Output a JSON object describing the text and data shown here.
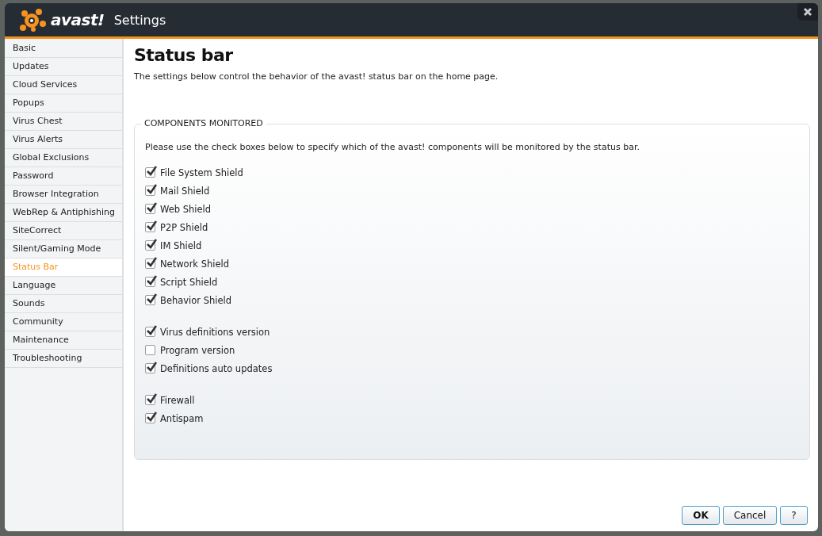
{
  "window": {
    "logo": "avast!",
    "title": "Settings"
  },
  "sidebar": {
    "items": [
      {
        "label": "Basic",
        "selected": false
      },
      {
        "label": "Updates",
        "selected": false
      },
      {
        "label": "Cloud Services",
        "selected": false
      },
      {
        "label": "Popups",
        "selected": false
      },
      {
        "label": "Virus Chest",
        "selected": false
      },
      {
        "label": "Virus Alerts",
        "selected": false
      },
      {
        "label": "Global Exclusions",
        "selected": false
      },
      {
        "label": "Password",
        "selected": false
      },
      {
        "label": "Browser Integration",
        "selected": false
      },
      {
        "label": "WebRep & Antiphishing",
        "selected": false
      },
      {
        "label": "SiteCorrect",
        "selected": false
      },
      {
        "label": "Silent/Gaming Mode",
        "selected": false
      },
      {
        "label": "Status Bar",
        "selected": true
      },
      {
        "label": "Language",
        "selected": false
      },
      {
        "label": "Sounds",
        "selected": false
      },
      {
        "label": "Community",
        "selected": false
      },
      {
        "label": "Maintenance",
        "selected": false
      },
      {
        "label": "Troubleshooting",
        "selected": false
      }
    ]
  },
  "page": {
    "title": "Status bar",
    "description": "The settings below control the behavior of the avast! status bar on the home page."
  },
  "group": {
    "legend": "COMPONENTS MONITORED",
    "intro": "Please use the check boxes below to specify which of the avast! components will be monitored by the status bar.",
    "sections": [
      [
        {
          "label": "File System Shield",
          "checked": true
        },
        {
          "label": "Mail Shield",
          "checked": true
        },
        {
          "label": "Web Shield",
          "checked": true
        },
        {
          "label": "P2P Shield",
          "checked": true
        },
        {
          "label": "IM Shield",
          "checked": true
        },
        {
          "label": "Network Shield",
          "checked": true
        },
        {
          "label": "Script Shield",
          "checked": true
        },
        {
          "label": "Behavior Shield",
          "checked": true
        }
      ],
      [
        {
          "label": "Virus definitions version",
          "checked": true
        },
        {
          "label": "Program version",
          "checked": false
        },
        {
          "label": "Definitions auto updates",
          "checked": true
        }
      ],
      [
        {
          "label": "Firewall",
          "checked": true
        },
        {
          "label": "Antispam",
          "checked": true
        }
      ]
    ]
  },
  "buttons": [
    "OK",
    "Cancel",
    "?"
  ]
}
